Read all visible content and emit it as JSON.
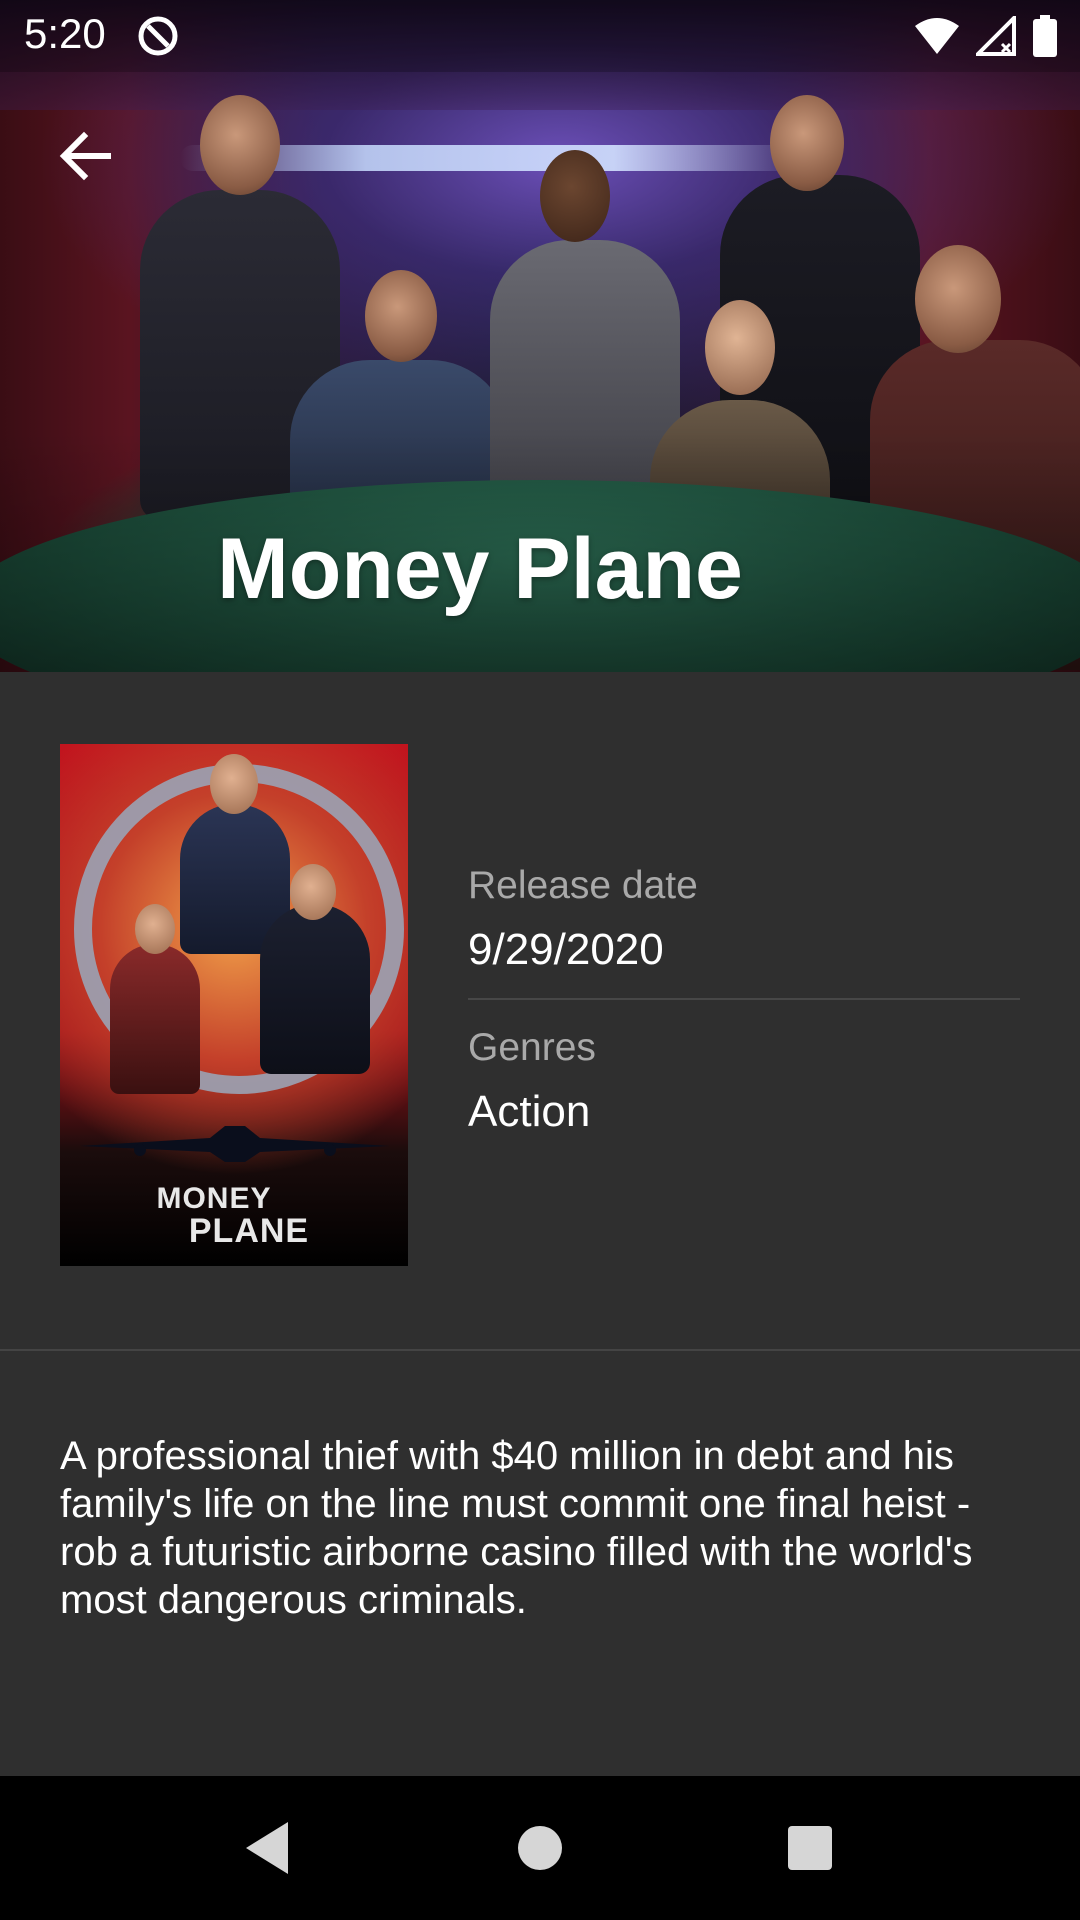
{
  "status_bar": {
    "time": "5:20",
    "icons": [
      "app-notification-icon",
      "wifi-icon",
      "cellular-signal-icon",
      "battery-icon"
    ]
  },
  "header": {
    "back_icon": "arrow-back-icon",
    "title": "Money Plane"
  },
  "poster": {
    "line1": "MONEY",
    "line2": "PLANE"
  },
  "details": {
    "release_date_label": "Release date",
    "release_date_value": "9/29/2020",
    "genres_label": "Genres",
    "genres_value": "Action"
  },
  "overview": "A professional thief with $40 million in debt and his family's life on the line must commit one final heist - rob a futuristic airborne casino filled with the world's most dangerous criminals.",
  "nav_bar": {
    "back": "nav-back-icon",
    "home": "nav-home-icon",
    "recents": "nav-recents-icon"
  },
  "colors": {
    "background": "#2f2f2f",
    "label_gray": "#a9a9a9",
    "divider": "#474747",
    "nav_bar": "#000000"
  }
}
